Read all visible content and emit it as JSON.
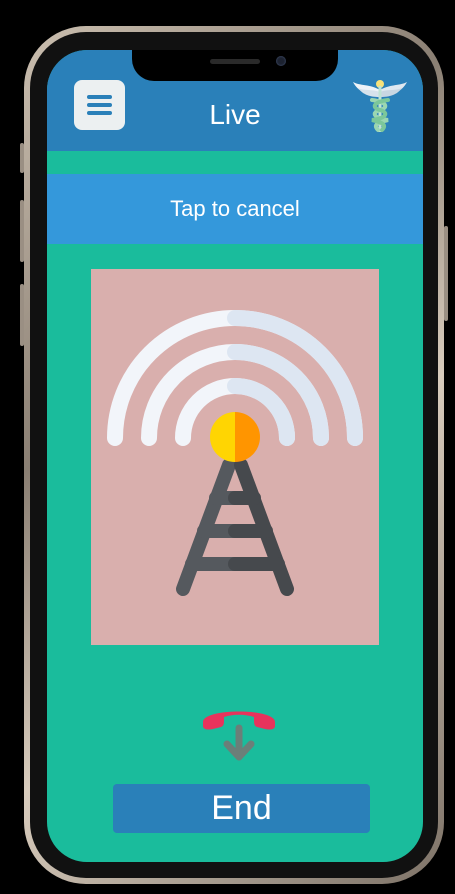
{
  "header": {
    "title": "Live",
    "menu_icon": "hamburger-menu-icon",
    "logo_icon": "caduceus-icon"
  },
  "cancel_bar": {
    "label": "Tap to cancel"
  },
  "signal": {
    "icon": "broadcast-tower-icon"
  },
  "end_call": {
    "icon": "hang-up-phone-icon",
    "label": "End"
  },
  "colors": {
    "header": "#2a80b9",
    "background": "#1abc9c",
    "cancel_bar": "#3498db",
    "card": "#d9afad",
    "end_button": "#2a80b9",
    "hangup_red": "#e8335c"
  }
}
